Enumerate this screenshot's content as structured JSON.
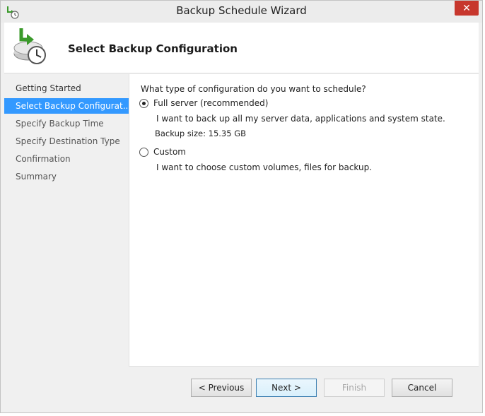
{
  "window": {
    "title": "Backup Schedule Wizard",
    "close_glyph": "✕"
  },
  "header": {
    "title": "Select Backup Configuration",
    "icon": "backup-clock-icon"
  },
  "nav": {
    "items": [
      {
        "label": "Getting Started",
        "state": "visited"
      },
      {
        "label": "Select Backup Configurat...",
        "state": "active"
      },
      {
        "label": "Specify Backup Time",
        "state": "pending"
      },
      {
        "label": "Specify Destination Type",
        "state": "pending"
      },
      {
        "label": "Confirmation",
        "state": "pending"
      },
      {
        "label": "Summary",
        "state": "pending"
      }
    ]
  },
  "content": {
    "question": "What type of configuration do you want to schedule?",
    "options": [
      {
        "label": "Full server (recommended)",
        "checked": true,
        "description": "I want to back up all my server data, applications and system state.",
        "size": "Backup size: 15.35 GB"
      },
      {
        "label": "Custom",
        "checked": false,
        "description": "I want to choose custom volumes, files for backup."
      }
    ]
  },
  "footer": {
    "previous_label": "< Previous",
    "next_label": "Next >",
    "finish_label": "Finish",
    "cancel_label": "Cancel"
  },
  "colors": {
    "accent": "#3399ff",
    "close": "#c7372d",
    "window_bg": "#f0f0f0"
  }
}
